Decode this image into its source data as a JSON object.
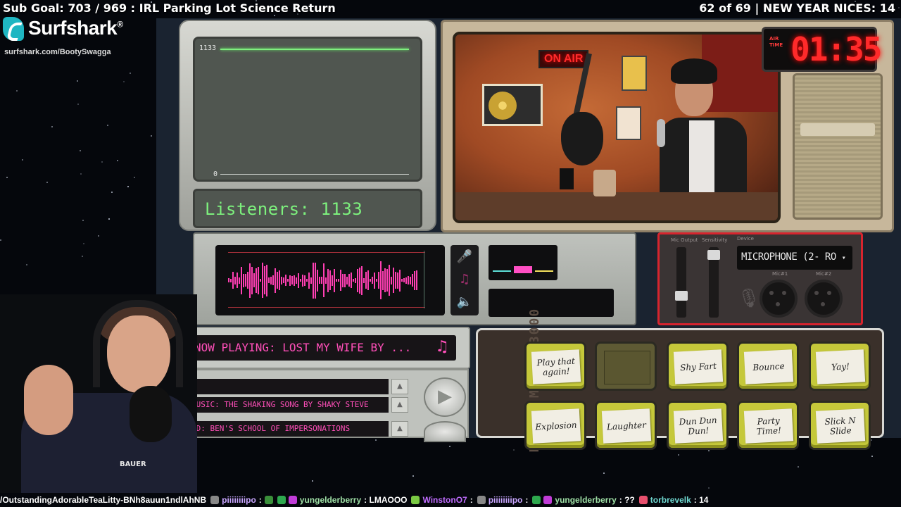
{
  "overlay": {
    "sub_goal": "Sub Goal: 703 / 969 : IRL Parking Lot Science Return",
    "nices": "62 of 69 | NEW YEAR NICES: 14",
    "sponsor_name": "Surfshark",
    "sponsor_mark": "®",
    "sponsor_url": "surfshark.com/BootySwagga"
  },
  "graph": {
    "max_label": "1133",
    "min_label": "0",
    "listeners_text": "Listeners: 1133",
    "line_color": "#7fef7f"
  },
  "tv": {
    "onair_sign": "ON AIR",
    "timer_label_line1": "AIR",
    "timer_label_line2": "TIME",
    "timer_value": "01:35"
  },
  "mixer": {
    "mic_icon": "microphone-icon",
    "music_icon": "music-note-icon",
    "sound_icon": "speaker-icon",
    "waveform_color": "#ff3fb3"
  },
  "mic_settings": {
    "slider1_label": "Mic Output",
    "slider2_label": "Sensitivity",
    "device_label": "Device",
    "device_value": "MICROPHONE (2- RO",
    "xlr1_label": "Mic#1",
    "xlr2_label": "Mic#2",
    "accent_color": "#d7242e"
  },
  "now_playing": {
    "text": "NOW PLAYING: LOST MY WIFE BY ...",
    "note_icon": "♫"
  },
  "playlist": {
    "rows": [
      {
        "text": ""
      },
      {
        "text": "MUSIC: THE SHAKING SONG BY SHAKY STEVE"
      },
      {
        "text": "AD: BEN'S SCHOOL OF IMPERSONATIONS"
      }
    ],
    "scroll_icon": "▲",
    "play_icon": "▶"
  },
  "noise_maker": {
    "title": "NOISE MAKER 3000",
    "buttons": [
      {
        "label": "Play that again!"
      },
      {
        "label": ""
      },
      {
        "label": "Shy Fart"
      },
      {
        "label": "Bounce"
      },
      {
        "label": "Yay!"
      },
      {
        "label": "Explosion"
      },
      {
        "label": "Laughter"
      },
      {
        "label": "Dun Dun Dun!"
      },
      {
        "label": "Party Time!"
      },
      {
        "label": "Slick N Slide"
      }
    ]
  },
  "webcam": {
    "shirt_brand": "BAUER"
  },
  "chat": [
    {
      "user": "/OutstandingAdorableTeaLitty-BNh8auun1ndlAhNB",
      "msg": ""
    },
    {
      "user": "piiiiiiiipo",
      "msg": ":"
    },
    {
      "user": "yungelderberry",
      "msg": ": LMAOOO"
    },
    {
      "user": "WinstonO7",
      "msg": ":"
    },
    {
      "user": "piiiiiiiipo",
      "msg": ":"
    },
    {
      "user": "yungelderberry",
      "msg": ": ??"
    },
    {
      "user": "torbrevelk",
      "msg": ": 14"
    }
  ]
}
